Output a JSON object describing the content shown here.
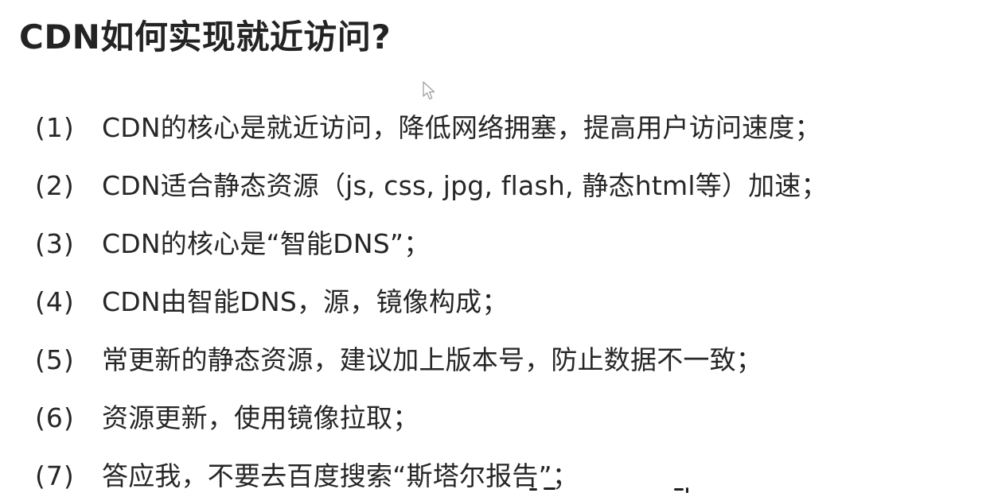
{
  "slide": {
    "title": "CDN如何实现就近访问?",
    "items": [
      {
        "number": "(1)",
        "text": "CDN的核心是就近访问，降低网络拥塞，提高用户访问速度；"
      },
      {
        "number": "(2)",
        "text": "CDN适合静态资源（js, css, jpg, flash, 静态html等）加速；"
      },
      {
        "number": "(3)",
        "text": "CDN的核心是“智能DNS”；"
      },
      {
        "number": "(4)",
        "text": "CDN由智能DNS，源，镜像构成；"
      },
      {
        "number": "(5)",
        "text": "常更新的静态资源，建议加上版本号，防止数据不一致；"
      },
      {
        "number": "(6)",
        "text": "资源更新，使用镜像拉取；"
      },
      {
        "number": "(7)",
        "text": "答应我，不要去百度搜索“斯塔尔报告”；"
      }
    ]
  },
  "icons": {
    "cursor": "mouse-pointer-icon"
  },
  "colors": {
    "background": "#ffffff",
    "title_text": "#232323",
    "body_text": "#262626"
  }
}
